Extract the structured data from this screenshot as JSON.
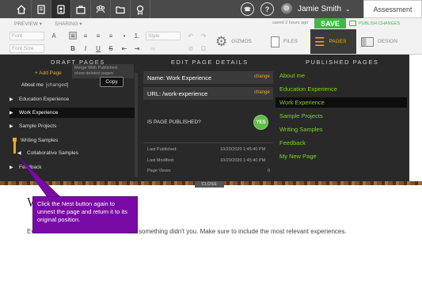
{
  "topnav": {
    "icons": [
      "home-icon",
      "scroll-icon",
      "portfolio-icon",
      "briefcase-icon",
      "community-icon",
      "folder-icon",
      "award-icon"
    ],
    "help_icon": "?",
    "user_name": "Jamie Smith",
    "assessment_label": "Assessment"
  },
  "toolbar": {
    "preview_label": "PREVIEW",
    "sharing_label": "SHARING",
    "font_placeholder": "Font",
    "font_size_placeholder": "Font Size",
    "style_placeholder": "Style",
    "saved_status": "saved 2 hours ago",
    "save_label": "SAVE",
    "publish_label": "PUBLISH CHANGES",
    "gizmos_label": "GIZMOS",
    "files_label": "FILES",
    "pages_label": "PAGES",
    "design_label": "DESIGN"
  },
  "drafts": {
    "title": "DRAFT PAGES",
    "add_page_label": "+ Add Page",
    "merge_tip": "Merge With Published",
    "merge_tip_sub": "show deleted pages",
    "copy_label": "Copy",
    "about_me": "About me",
    "changed_badge": "[changed]",
    "items": [
      "Education Experience",
      "Work Experience",
      "Sample Projects",
      "Writing Samples",
      "Collaborative Samples",
      "Feedback"
    ]
  },
  "edit": {
    "title": "EDIT PAGE DETAILS",
    "name_field": "Name: Work Experience",
    "url_field": "URL: /work-experience",
    "change_label": "change",
    "published_question": "IS PAGE PUBLISHED?",
    "published_value": "YES",
    "last_published_label": "Last Published:",
    "last_published_value": "10/20/2020 1:45:40 PM",
    "last_modified_label": "Last Modified:",
    "last_modified_value": "10/20/2020 1:45:40 PM",
    "page_views_label": "Page Views:",
    "page_views_value": "0"
  },
  "published": {
    "title": "PUBLISHED PAGES",
    "items": [
      "About me",
      "Education Experience",
      "Work Experience",
      "Sample Projects",
      "Writing Samples",
      "Feedback",
      "My New Page"
    ]
  },
  "close_label": "CLOSE",
  "page": {
    "title_visible": "W",
    "body_start": "Ev",
    "body_end": "something didn't you. Make sure to include the most relevant experiences."
  },
  "callout": {
    "text": "Click the Nest button again to unnest the page and return it to its original position."
  },
  "colors": {
    "accent_green": "#44b649",
    "published_green": "#7ed321",
    "change_orange": "#e8a92f",
    "callout_purple": "#7a0aa6"
  }
}
